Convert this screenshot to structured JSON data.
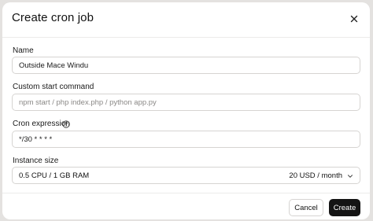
{
  "dialog": {
    "title": "Create cron job",
    "close_icon": "close-icon"
  },
  "form": {
    "name": {
      "label": "Name",
      "value": "Outside Mace Windu"
    },
    "start_command": {
      "label": "Custom start command",
      "placeholder": "npm start / php index.php / python app.py",
      "value": ""
    },
    "cron_expression": {
      "label": "Cron expression",
      "help_icon": "question-circle-icon",
      "value": "*/30 * * * *"
    },
    "instance_size": {
      "label": "Instance size",
      "selected": "0.5 CPU / 1 GB RAM",
      "price": "20 USD / month",
      "chevron_icon": "chevron-down-icon"
    }
  },
  "footer": {
    "cancel_label": "Cancel",
    "create_label": "Create"
  },
  "colors": {
    "primary_button": "#141414",
    "border": "#d6d4d2",
    "backdrop": "#e4e2e0"
  }
}
